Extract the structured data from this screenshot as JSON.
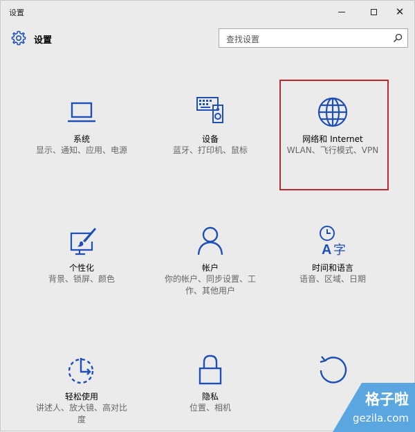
{
  "window": {
    "title": "设置"
  },
  "header": {
    "title": "设置",
    "search_placeholder": "查找设置"
  },
  "accent_color": "#1e4fb5",
  "highlight_color": "#c0272d",
  "tiles": [
    {
      "icon": "laptop-icon",
      "name": "系统",
      "desc": "显示、通知、应用、电源"
    },
    {
      "icon": "keyboard-speaker-icon",
      "name": "设备",
      "desc": "蓝牙、打印机、鼠标"
    },
    {
      "icon": "globe-icon",
      "name": "网络和 Internet",
      "desc": "WLAN、飞行模式、VPN"
    },
    {
      "icon": "paint-monitor-icon",
      "name": "个性化",
      "desc": "背景、锁屏、颜色"
    },
    {
      "icon": "person-icon",
      "name": "帐户",
      "desc": "你的帐户、同步设置、工作、其他用户"
    },
    {
      "icon": "time-language-icon",
      "name": "时间和语言",
      "desc": "语音、区域、日期"
    },
    {
      "icon": "ease-of-access-icon",
      "name": "轻松使用",
      "desc": "讲述人、放大镜、高对比度"
    },
    {
      "icon": "lock-icon",
      "name": "隐私",
      "desc": "位置、相机"
    },
    {
      "icon": "update-refresh-icon",
      "name": "",
      "desc": ""
    }
  ],
  "watermark": {
    "line1": "格子啦",
    "line2": "gezila.com"
  }
}
